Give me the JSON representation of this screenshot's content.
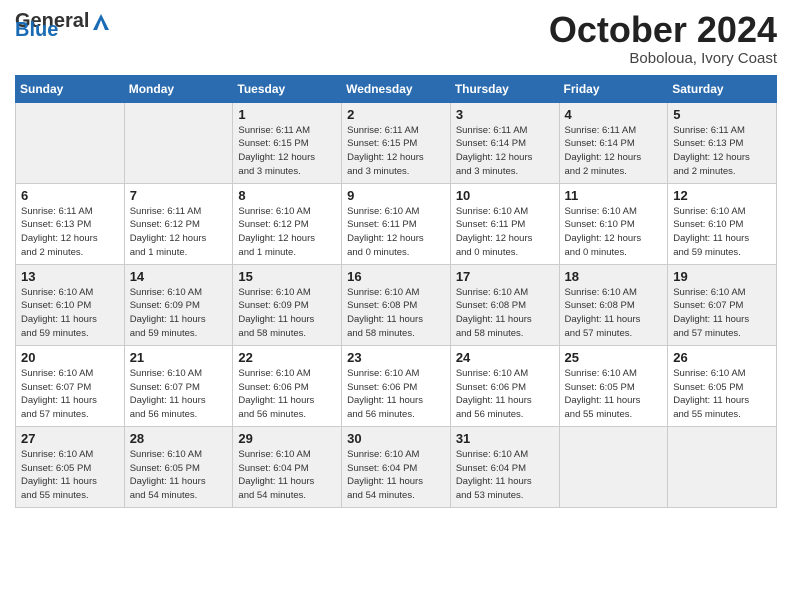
{
  "logo": {
    "general": "General",
    "blue": "Blue"
  },
  "header": {
    "month": "October 2024",
    "location": "Boboloua, Ivory Coast"
  },
  "weekdays": [
    "Sunday",
    "Monday",
    "Tuesday",
    "Wednesday",
    "Thursday",
    "Friday",
    "Saturday"
  ],
  "weeks": [
    [
      {
        "day": "",
        "info": ""
      },
      {
        "day": "",
        "info": ""
      },
      {
        "day": "1",
        "info": "Sunrise: 6:11 AM\nSunset: 6:15 PM\nDaylight: 12 hours\nand 3 minutes."
      },
      {
        "day": "2",
        "info": "Sunrise: 6:11 AM\nSunset: 6:15 PM\nDaylight: 12 hours\nand 3 minutes."
      },
      {
        "day": "3",
        "info": "Sunrise: 6:11 AM\nSunset: 6:14 PM\nDaylight: 12 hours\nand 3 minutes."
      },
      {
        "day": "4",
        "info": "Sunrise: 6:11 AM\nSunset: 6:14 PM\nDaylight: 12 hours\nand 2 minutes."
      },
      {
        "day": "5",
        "info": "Sunrise: 6:11 AM\nSunset: 6:13 PM\nDaylight: 12 hours\nand 2 minutes."
      }
    ],
    [
      {
        "day": "6",
        "info": "Sunrise: 6:11 AM\nSunset: 6:13 PM\nDaylight: 12 hours\nand 2 minutes."
      },
      {
        "day": "7",
        "info": "Sunrise: 6:11 AM\nSunset: 6:12 PM\nDaylight: 12 hours\nand 1 minute."
      },
      {
        "day": "8",
        "info": "Sunrise: 6:10 AM\nSunset: 6:12 PM\nDaylight: 12 hours\nand 1 minute."
      },
      {
        "day": "9",
        "info": "Sunrise: 6:10 AM\nSunset: 6:11 PM\nDaylight: 12 hours\nand 0 minutes."
      },
      {
        "day": "10",
        "info": "Sunrise: 6:10 AM\nSunset: 6:11 PM\nDaylight: 12 hours\nand 0 minutes."
      },
      {
        "day": "11",
        "info": "Sunrise: 6:10 AM\nSunset: 6:10 PM\nDaylight: 12 hours\nand 0 minutes."
      },
      {
        "day": "12",
        "info": "Sunrise: 6:10 AM\nSunset: 6:10 PM\nDaylight: 11 hours\nand 59 minutes."
      }
    ],
    [
      {
        "day": "13",
        "info": "Sunrise: 6:10 AM\nSunset: 6:10 PM\nDaylight: 11 hours\nand 59 minutes."
      },
      {
        "day": "14",
        "info": "Sunrise: 6:10 AM\nSunset: 6:09 PM\nDaylight: 11 hours\nand 59 minutes."
      },
      {
        "day": "15",
        "info": "Sunrise: 6:10 AM\nSunset: 6:09 PM\nDaylight: 11 hours\nand 58 minutes."
      },
      {
        "day": "16",
        "info": "Sunrise: 6:10 AM\nSunset: 6:08 PM\nDaylight: 11 hours\nand 58 minutes."
      },
      {
        "day": "17",
        "info": "Sunrise: 6:10 AM\nSunset: 6:08 PM\nDaylight: 11 hours\nand 58 minutes."
      },
      {
        "day": "18",
        "info": "Sunrise: 6:10 AM\nSunset: 6:08 PM\nDaylight: 11 hours\nand 57 minutes."
      },
      {
        "day": "19",
        "info": "Sunrise: 6:10 AM\nSunset: 6:07 PM\nDaylight: 11 hours\nand 57 minutes."
      }
    ],
    [
      {
        "day": "20",
        "info": "Sunrise: 6:10 AM\nSunset: 6:07 PM\nDaylight: 11 hours\nand 57 minutes."
      },
      {
        "day": "21",
        "info": "Sunrise: 6:10 AM\nSunset: 6:07 PM\nDaylight: 11 hours\nand 56 minutes."
      },
      {
        "day": "22",
        "info": "Sunrise: 6:10 AM\nSunset: 6:06 PM\nDaylight: 11 hours\nand 56 minutes."
      },
      {
        "day": "23",
        "info": "Sunrise: 6:10 AM\nSunset: 6:06 PM\nDaylight: 11 hours\nand 56 minutes."
      },
      {
        "day": "24",
        "info": "Sunrise: 6:10 AM\nSunset: 6:06 PM\nDaylight: 11 hours\nand 56 minutes."
      },
      {
        "day": "25",
        "info": "Sunrise: 6:10 AM\nSunset: 6:05 PM\nDaylight: 11 hours\nand 55 minutes."
      },
      {
        "day": "26",
        "info": "Sunrise: 6:10 AM\nSunset: 6:05 PM\nDaylight: 11 hours\nand 55 minutes."
      }
    ],
    [
      {
        "day": "27",
        "info": "Sunrise: 6:10 AM\nSunset: 6:05 PM\nDaylight: 11 hours\nand 55 minutes."
      },
      {
        "day": "28",
        "info": "Sunrise: 6:10 AM\nSunset: 6:05 PM\nDaylight: 11 hours\nand 54 minutes."
      },
      {
        "day": "29",
        "info": "Sunrise: 6:10 AM\nSunset: 6:04 PM\nDaylight: 11 hours\nand 54 minutes."
      },
      {
        "day": "30",
        "info": "Sunrise: 6:10 AM\nSunset: 6:04 PM\nDaylight: 11 hours\nand 54 minutes."
      },
      {
        "day": "31",
        "info": "Sunrise: 6:10 AM\nSunset: 6:04 PM\nDaylight: 11 hours\nand 53 minutes."
      },
      {
        "day": "",
        "info": ""
      },
      {
        "day": "",
        "info": ""
      }
    ]
  ]
}
